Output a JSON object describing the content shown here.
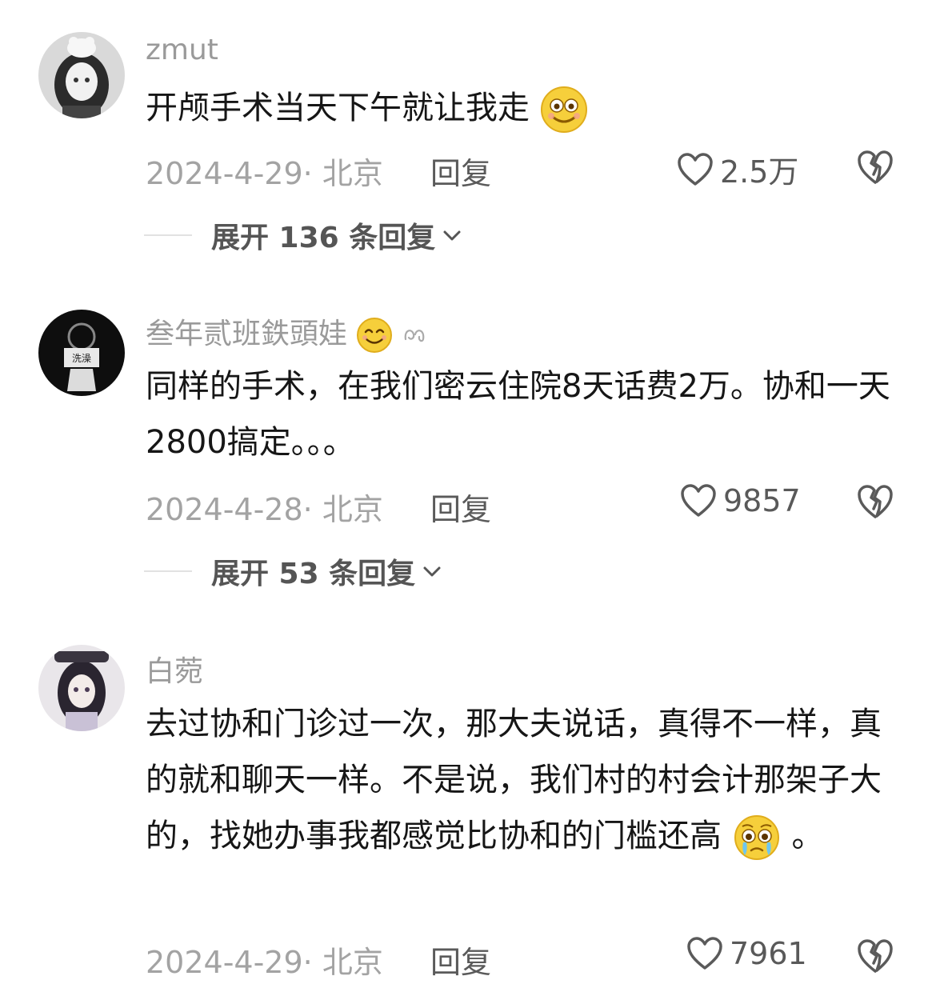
{
  "comments": [
    {
      "username": "zmut",
      "text": "开颅手术当天下午就让我走",
      "date_location": "2024-4-29· 北京",
      "reply_label": "回复",
      "likes": "2.5万",
      "expand_label": "展开 136 条回复"
    },
    {
      "username": "叁年贰班鉄頭娃",
      "text": "同样的手术，在我们密云住院8天话费2万。协和一天2800搞定。。。",
      "date_location": "2024-4-28· 北京",
      "reply_label": "回复",
      "likes": "9857",
      "expand_label": "展开 53 条回复"
    },
    {
      "username": "白菀",
      "text_before_emoji": "去过协和门诊过一次，那大夫说话，真得不一样，真的就和聊天一样。不是说，我们村的村会计那架子大的，找她办事我都感觉比协和的门槛还高",
      "text_after_emoji": "。",
      "date_location": "2024-4-29· 北京",
      "reply_label": "回复",
      "likes": "7961"
    }
  ],
  "icons": {
    "like": "heart-outline-icon",
    "dislike": "broken-heart-icon",
    "expand": "chevron-down-icon"
  },
  "colors": {
    "username": "#9a9a9a",
    "meta": "#a3a3a3",
    "text": "#161616"
  }
}
